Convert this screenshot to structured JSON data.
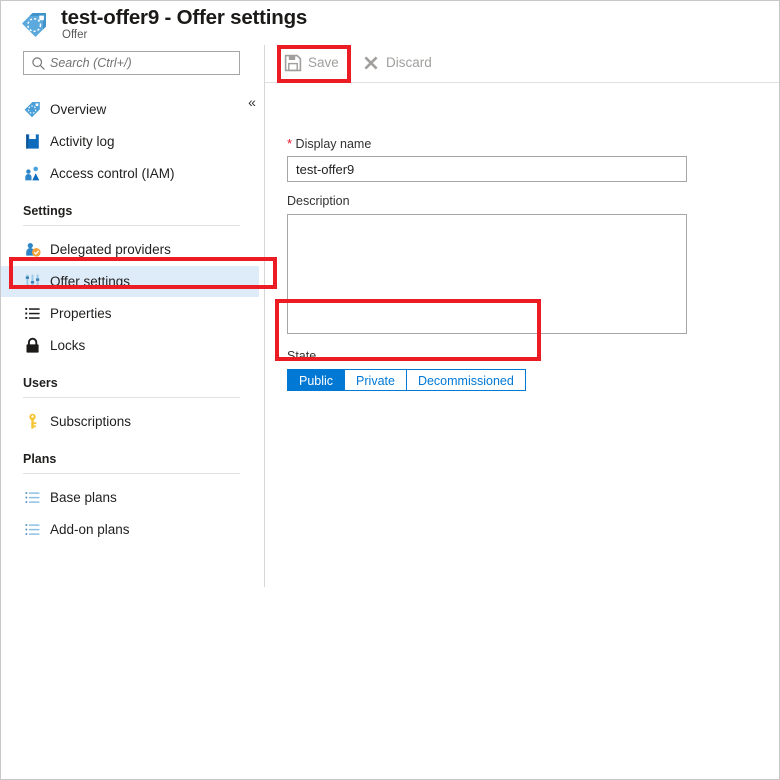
{
  "header": {
    "icon": "offer-tag-icon",
    "title": "test-offer9 - Offer settings",
    "subtitle": "Offer"
  },
  "sidebar": {
    "search": {
      "placeholder": "Search (Ctrl+/)",
      "value": "",
      "icon": "search-icon"
    },
    "collapse": {
      "icon": "double-chevron-left-icon",
      "label": "«"
    },
    "items": [
      {
        "label": "Overview",
        "icon": "tag-icon",
        "selected": false
      },
      {
        "label": "Activity log",
        "icon": "activity-log-icon",
        "selected": false
      },
      {
        "label": "Access control (IAM)",
        "icon": "access-control-icon",
        "selected": false
      }
    ],
    "groups": [
      {
        "label": "Settings",
        "items": [
          {
            "label": "Delegated providers",
            "icon": "delegated-providers-icon",
            "selected": false
          },
          {
            "label": "Offer settings",
            "icon": "sliders-icon",
            "selected": true
          },
          {
            "label": "Properties",
            "icon": "properties-list-icon",
            "selected": false
          },
          {
            "label": "Locks",
            "icon": "lock-icon",
            "selected": false
          }
        ]
      },
      {
        "label": "Users",
        "items": [
          {
            "label": "Subscriptions",
            "icon": "key-icon",
            "selected": false
          }
        ]
      },
      {
        "label": "Plans",
        "items": [
          {
            "label": "Base plans",
            "icon": "list-icon",
            "selected": false
          },
          {
            "label": "Add-on plans",
            "icon": "list-icon",
            "selected": false
          }
        ]
      }
    ]
  },
  "command_bar": {
    "save": {
      "label": "Save",
      "icon": "save-floppy-icon",
      "disabled": true
    },
    "discard": {
      "label": "Discard",
      "icon": "close-x-icon",
      "disabled": true
    }
  },
  "form": {
    "display_name": {
      "label": "Display name",
      "required_marker": "*",
      "value": "test-offer9",
      "placeholder": ""
    },
    "description": {
      "label": "Description",
      "value": "",
      "placeholder": ""
    },
    "state": {
      "label": "State",
      "options": [
        "Public",
        "Private",
        "Decommissioned"
      ],
      "selected": "Public"
    }
  },
  "colors": {
    "accent_blue": "#0078d4",
    "selected_row": "#deecf9",
    "annotation_red": "#ec1c24",
    "required_red": "#e81123",
    "disabled_text": "#a19f9d",
    "key_yellow": "#ffc20e"
  }
}
